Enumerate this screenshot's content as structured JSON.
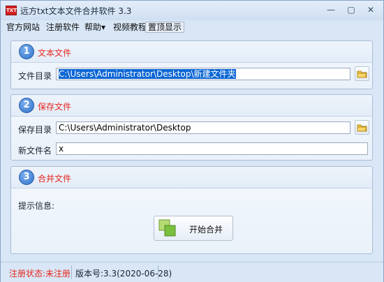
{
  "window": {
    "title": "远方txt文本文件合并软件 3.3",
    "icon": "txt-app-icon",
    "icon_text": "TXT",
    "controls": [
      "minimize-icon",
      "restore-icon",
      "close-icon"
    ],
    "control_glyphs": {
      "minimize": "—",
      "restore": "▢",
      "close": "✕"
    }
  },
  "menu": {
    "items": [
      {
        "label": "官方网站"
      },
      {
        "label": "注册软件"
      },
      {
        "label": "帮助▾"
      },
      {
        "label": "视频教程"
      },
      {
        "label": "置顶显示"
      }
    ]
  },
  "panels": {
    "text_files": {
      "number": "1",
      "title": "文本文件",
      "dir_label": "文件目录",
      "dir_value": "C:\\Users\\Administrator\\Desktop\\新建文件夹"
    },
    "save_file": {
      "number": "2",
      "title": "保存文件",
      "save_dir_label": "保存目录",
      "save_dir_value": "C:\\Users\\Administrator\\Desktop",
      "new_name_label": "新文件名",
      "new_name_value": "x"
    },
    "merge": {
      "number": "3",
      "title": "合并文件",
      "info_label": "提示信息:",
      "start_button": "开始合并"
    }
  },
  "status": {
    "registration": "注册状态:未注册",
    "version": "版本号:3.3(2020-06-28)"
  },
  "colors": {
    "accent_red": "#e8261d",
    "badge_blue": "#2e6fc7",
    "selection_blue": "#0c66d4",
    "window_bg": "#d8e6f5"
  }
}
